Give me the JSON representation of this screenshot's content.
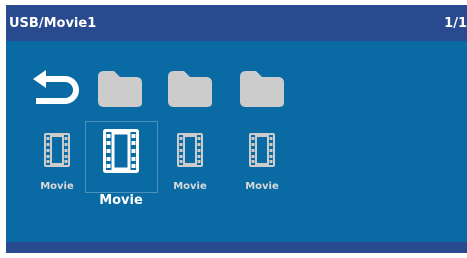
{
  "header": {
    "title": "USB/Movie1",
    "page": "1/1"
  },
  "colors": {
    "background": "#0a6aa4",
    "bars": "#2a4a90",
    "icon": "#cccccc",
    "selected_icon": "#ffffff"
  },
  "grid": {
    "row1": [
      {
        "type": "back",
        "icon": "return-arrow-icon"
      },
      {
        "type": "folder",
        "icon": "folder-icon"
      },
      {
        "type": "folder",
        "icon": "folder-icon"
      },
      {
        "type": "folder",
        "icon": "folder-icon"
      }
    ],
    "row2": [
      {
        "type": "movie",
        "icon": "film-icon",
        "label": "Movie",
        "selected": false
      },
      {
        "type": "movie",
        "icon": "film-icon",
        "label": "Movie",
        "selected": true
      },
      {
        "type": "movie",
        "icon": "film-icon",
        "label": "Movie",
        "selected": false
      },
      {
        "type": "movie",
        "icon": "film-icon",
        "label": "Movie",
        "selected": false
      }
    ]
  }
}
